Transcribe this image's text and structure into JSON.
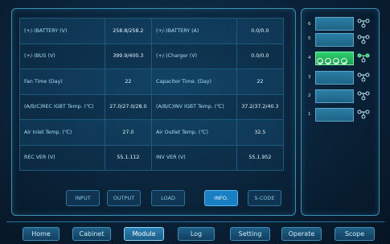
{
  "params": {
    "rows": [
      {
        "l1": "(+/-)BATTERY (V)",
        "v1": "258.8/258.2",
        "l2": "(+/-)BATTERY (A)",
        "v2": "0.0/0.0"
      },
      {
        "l1": "(+/-)BUS (V)",
        "v1": "399.9/400.3",
        "l2": "(+/-)Charger (V)",
        "v2": "0.0/0.0"
      },
      {
        "l1": "Fan Time (Day)",
        "v1": "22",
        "l2": "Capacitor Time. (Day)",
        "v2": "22"
      },
      {
        "l1": "(A/B/C)REC IGBT Temp. (℃)",
        "v1": "27.0/27.0/28.0",
        "l2": "(A/B/C)INV IGBT Temp. (℃)",
        "v2": "37.2/37.2/40.3"
      },
      {
        "l1": "Air Inlet Temp. (℃)",
        "v1": "27.0",
        "l2": "Air Outlet Temp. (℃)",
        "v2": "32.5"
      },
      {
        "l1": "REC VER (V)",
        "v1": "55.1.112",
        "l2": "INV VER (V)",
        "v2": "55.1.952"
      }
    ]
  },
  "subtabs": {
    "input": "INPUT",
    "output": "OUTPUT",
    "load": "LOAD",
    "info": "INFO.",
    "scode": "S-CODE",
    "active": "INFO."
  },
  "modules": {
    "slots": [
      {
        "num": "6",
        "active": false
      },
      {
        "num": "5",
        "active": false
      },
      {
        "num": "4",
        "active": true
      },
      {
        "num": "3",
        "active": false
      },
      {
        "num": "2",
        "active": false
      },
      {
        "num": "1",
        "active": false
      }
    ]
  },
  "nav": {
    "home": "Home",
    "cabinet": "Cabinet",
    "module": "Module",
    "log": "Log",
    "setting": "Setting",
    "operate": "Operate",
    "scope": "Scope",
    "active": "Module"
  },
  "colors": {
    "accent": "#1a7fc2",
    "active_module": "#2ed06e",
    "frame": "#3a8fb5",
    "background": "#0a2238"
  }
}
